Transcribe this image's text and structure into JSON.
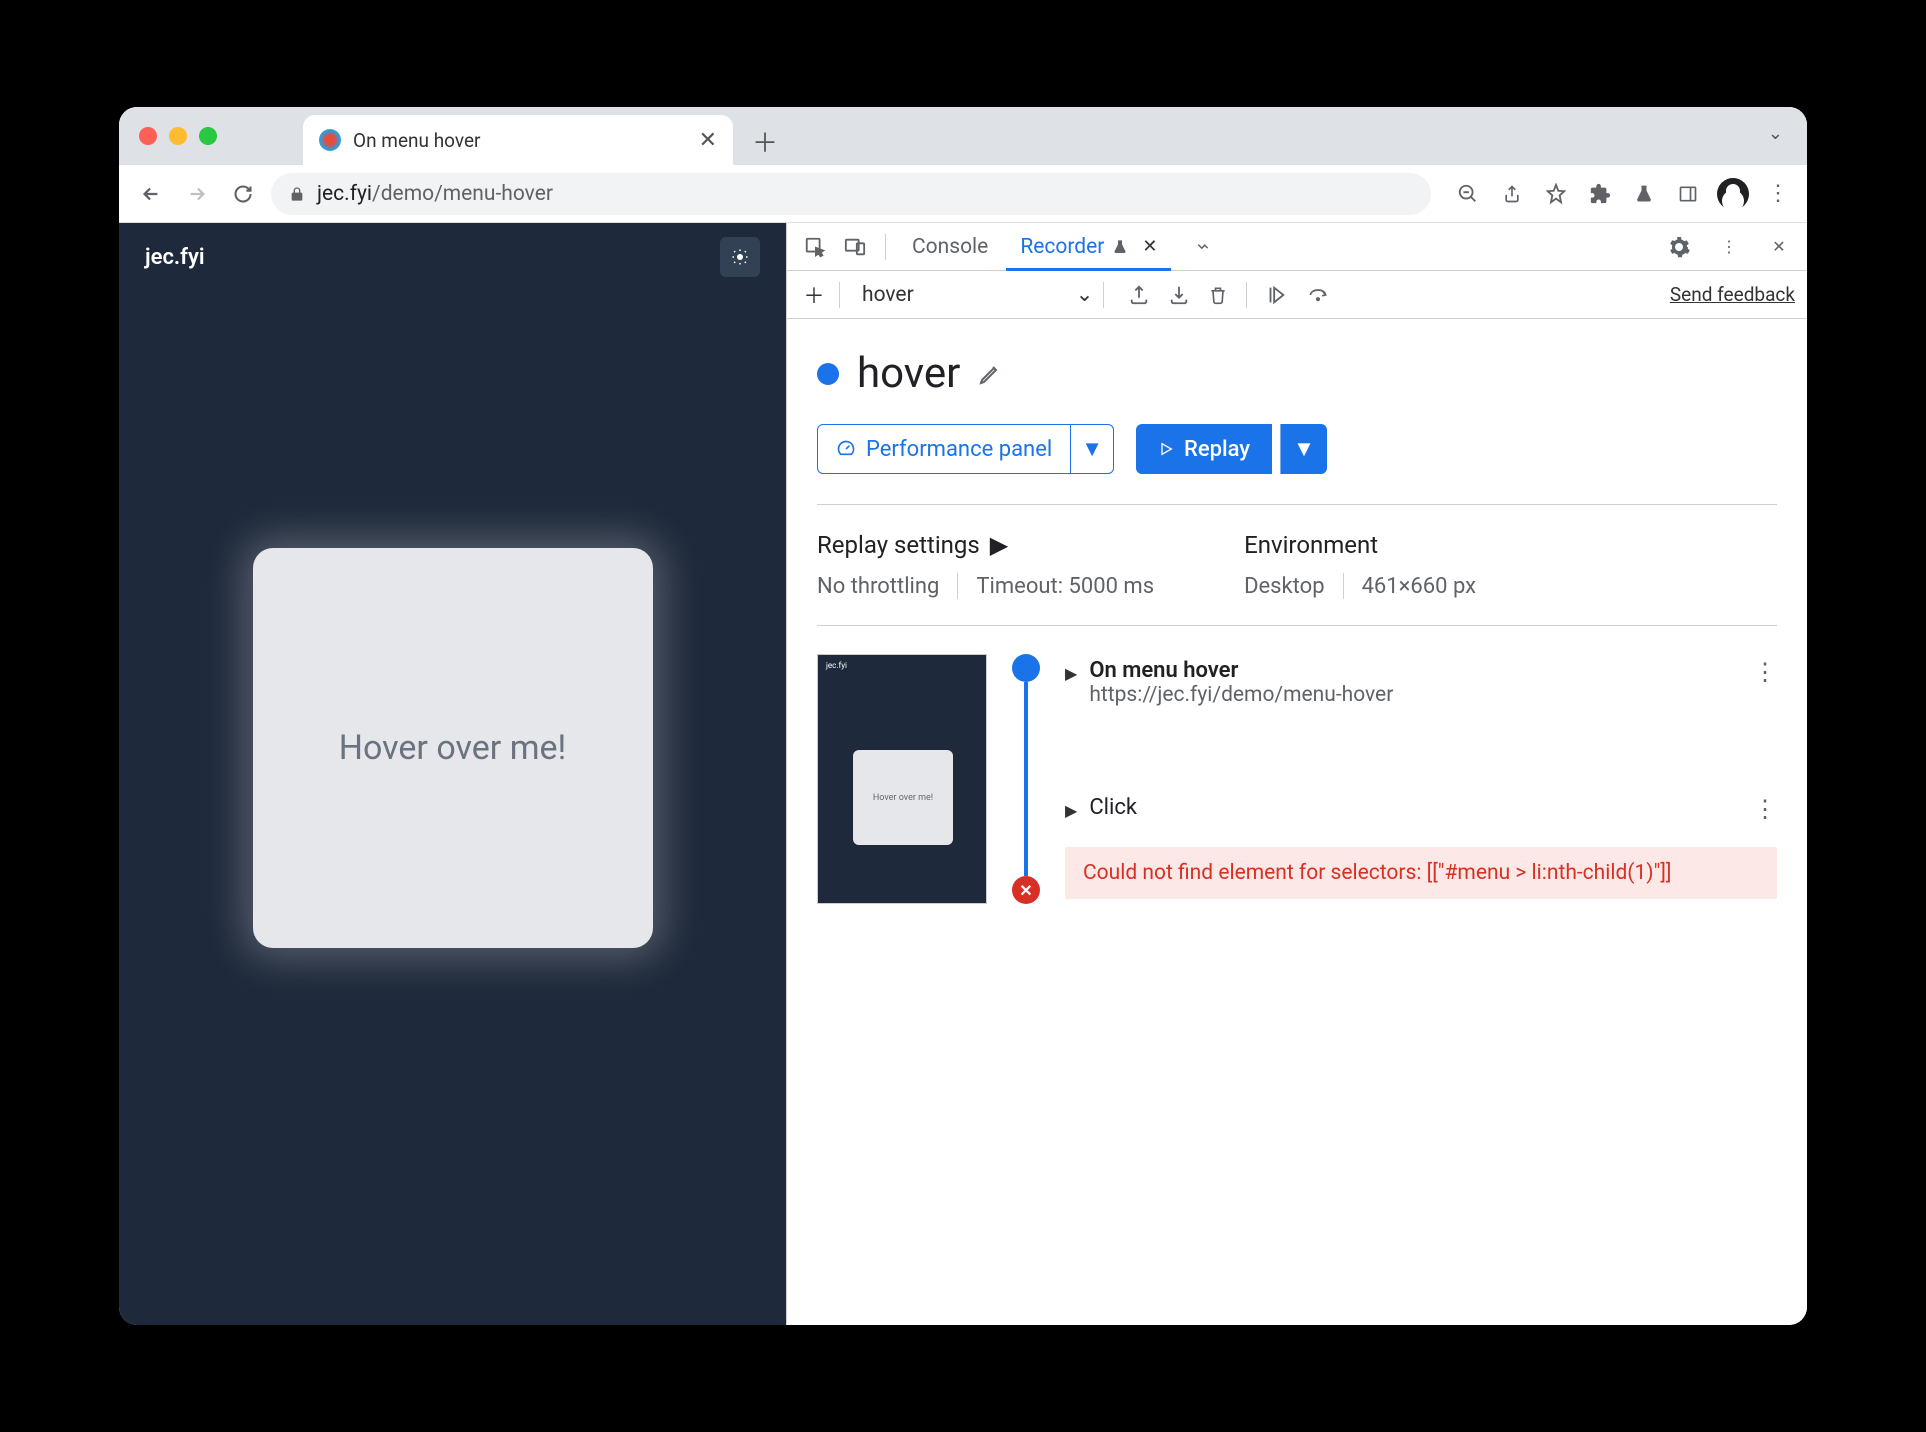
{
  "browser": {
    "tab_title": "On menu hover",
    "url_domain": "jec.fyi",
    "url_path": "/demo/menu-hover"
  },
  "page": {
    "logo_text": "jec.fyi",
    "hover_card_text": "Hover over me!"
  },
  "devtools": {
    "tabs": {
      "console": "Console",
      "recorder": "Recorder"
    },
    "toolbar": {
      "recording_name": "hover",
      "feedback": "Send feedback"
    },
    "title": "hover",
    "perf_button": "Performance panel",
    "replay_button": "Replay",
    "settings": {
      "replay_heading": "Replay settings",
      "throttling": "No throttling",
      "timeout": "Timeout: 5000 ms",
      "env_heading": "Environment",
      "device": "Desktop",
      "viewport": "461×660 px"
    },
    "steps": {
      "thumb_text": "Hover over me!",
      "thumb_header": "jec.fyi",
      "step1_title": "On menu hover",
      "step1_url": "https://jec.fyi/demo/menu-hover",
      "step2_title": "Click",
      "error_text": "Could not find element for selectors: [[\"#menu > li:nth-child(1)\"]]"
    }
  }
}
